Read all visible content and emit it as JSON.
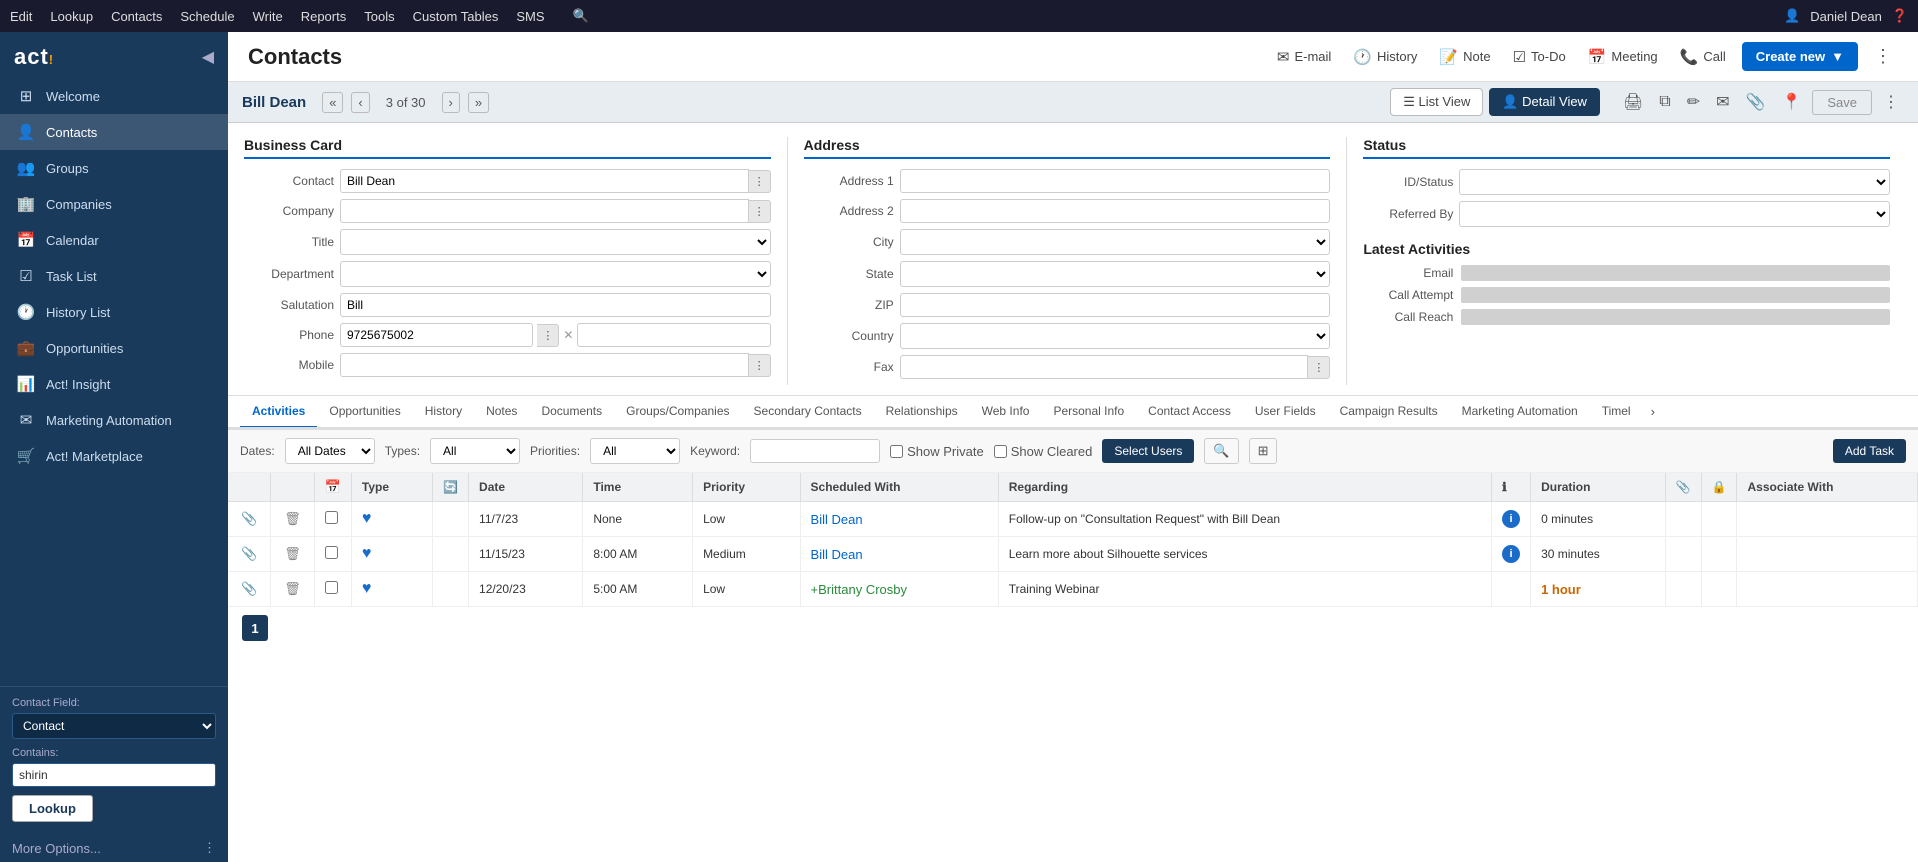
{
  "topmenu": {
    "items": [
      "Edit",
      "Lookup",
      "Contacts",
      "Schedule",
      "Write",
      "Reports",
      "Tools",
      "Custom Tables",
      "SMS"
    ],
    "user": "Daniel Dean"
  },
  "sidebar": {
    "logo": "act!",
    "nav_items": [
      {
        "label": "Welcome",
        "icon": "⊞"
      },
      {
        "label": "Contacts",
        "icon": "👤"
      },
      {
        "label": "Groups",
        "icon": "👥"
      },
      {
        "label": "Companies",
        "icon": "🏢"
      },
      {
        "label": "Calendar",
        "icon": "📅"
      },
      {
        "label": "Task List",
        "icon": "☑"
      },
      {
        "label": "History List",
        "icon": "🕐"
      },
      {
        "label": "Opportunities",
        "icon": "💼"
      },
      {
        "label": "Act! Insight",
        "icon": "📊"
      },
      {
        "label": "Marketing Automation",
        "icon": "✉"
      },
      {
        "label": "Act! Marketplace",
        "icon": "🛒"
      }
    ],
    "contact_field_label": "Contact Field:",
    "contact_field_value": "Contact",
    "contains_label": "Contains:",
    "contains_value": "shirin",
    "lookup_btn": "Lookup",
    "more_options": "More Options..."
  },
  "header": {
    "title": "Contacts",
    "actions": [
      {
        "label": "E-mail",
        "icon": "✉"
      },
      {
        "label": "History",
        "icon": "🕐"
      },
      {
        "label": "Note",
        "icon": "📝"
      },
      {
        "label": "To-Do",
        "icon": "☑"
      },
      {
        "label": "Meeting",
        "icon": "📅"
      },
      {
        "label": "Call",
        "icon": "📞"
      }
    ],
    "create_new": "Create new",
    "more_icon": "⋮"
  },
  "contact_nav": {
    "name": "Bill Dean",
    "count": "3 of 30",
    "list_view": "List View",
    "detail_view": "Detail View",
    "save_btn": "Save"
  },
  "business_card": {
    "title": "Business Card",
    "fields": {
      "contact_label": "Contact",
      "contact_value": "Bill Dean",
      "company_label": "Company",
      "company_value": "",
      "title_label": "Title",
      "title_value": "",
      "department_label": "Department",
      "department_value": "",
      "salutation_label": "Salutation",
      "salutation_value": "Bill",
      "phone_label": "Phone",
      "phone_value": "9725675002",
      "phone_ext": "",
      "mobile_label": "Mobile",
      "mobile_value": ""
    }
  },
  "address": {
    "title": "Address",
    "fields": {
      "address1_label": "Address 1",
      "address1_value": "",
      "address2_label": "Address 2",
      "address2_value": "",
      "city_label": "City",
      "city_value": "",
      "state_label": "State",
      "state_value": "",
      "zip_label": "ZIP",
      "zip_value": "",
      "country_label": "Country",
      "country_value": "",
      "fax_label": "Fax",
      "fax_value": ""
    }
  },
  "status": {
    "title": "Status",
    "id_status_label": "ID/Status",
    "id_status_value": "",
    "referred_by_label": "Referred By",
    "referred_by_value": ""
  },
  "latest_activities": {
    "title": "Latest Activities",
    "email_label": "Email",
    "call_attempt_label": "Call Attempt",
    "call_reach_label": "Call Reach"
  },
  "tabs": {
    "items": [
      "Activities",
      "Opportunities",
      "History",
      "Notes",
      "Documents",
      "Groups/Companies",
      "Secondary Contacts",
      "Relationships",
      "Web Info",
      "Personal Info",
      "Contact Access",
      "User Fields",
      "Campaign Results",
      "Marketing Automation",
      "Timel"
    ]
  },
  "filter_bar": {
    "dates_label": "Dates:",
    "dates_value": "All Dates",
    "types_label": "Types:",
    "types_value": "All",
    "priorities_label": "Priorities:",
    "priorities_value": "All",
    "keyword_label": "Keyword:",
    "keyword_value": "",
    "show_private": "Show Private",
    "show_cleared": "Show Cleared",
    "select_users_btn": "Select Users",
    "add_task_btn": "Add Task"
  },
  "activities_table": {
    "columns": [
      "",
      "",
      "Type",
      "",
      "Date",
      "Time",
      "Priority",
      "Scheduled With",
      "Regarding",
      "",
      "Duration",
      "",
      "",
      "Associate With"
    ],
    "rows": [
      {
        "type": "",
        "date": "11/7/23",
        "time": "None",
        "priority": "Low",
        "scheduled_with": "Bill Dean",
        "scheduled_with_link": true,
        "regarding": "Follow-up on \"Consultation Request\" with Bill Dean",
        "duration": "0 minutes",
        "duration_highlight": false,
        "associate_with": ""
      },
      {
        "type": "",
        "date": "11/15/23",
        "time": "8:00 AM",
        "priority": "Medium",
        "scheduled_with": "Bill Dean",
        "scheduled_with_link": true,
        "regarding": "Learn more about Silhouette services",
        "duration": "30 minutes",
        "duration_highlight": false,
        "associate_with": ""
      },
      {
        "type": "",
        "date": "12/20/23",
        "time": "5:00 AM",
        "priority": "Low",
        "scheduled_with": "+Brittany Crosby",
        "scheduled_with_link": true,
        "scheduled_with_green": true,
        "regarding": "Training Webinar",
        "duration": "1 hour",
        "duration_highlight": true,
        "associate_with": ""
      }
    ]
  },
  "pagination": {
    "current_page": "1"
  }
}
